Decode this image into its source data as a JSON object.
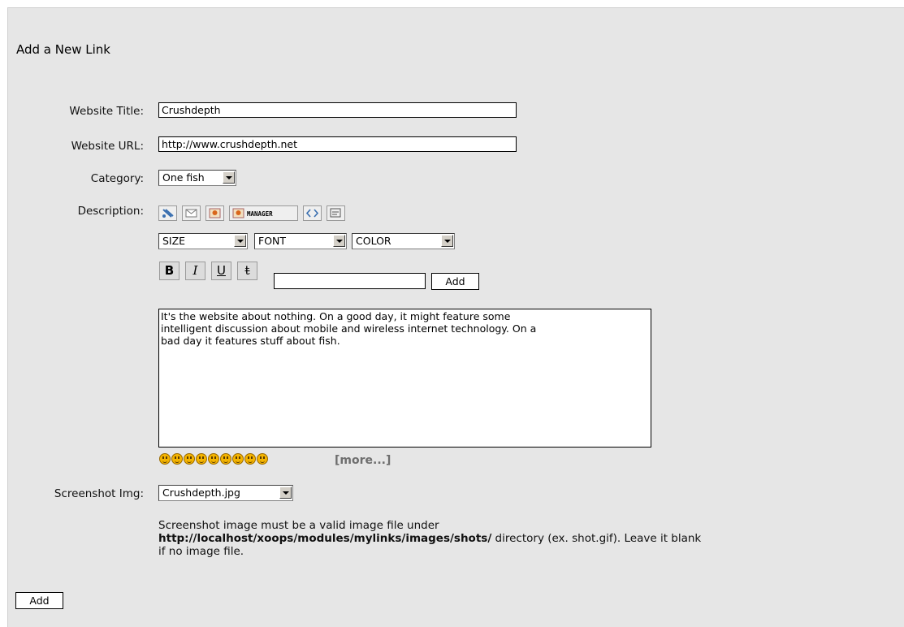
{
  "form": {
    "heading": "Add a New Link",
    "title_label": "Website Title:",
    "title_value": "Crushdepth",
    "url_label": "Website URL:",
    "url_value": "http://www.crushdepth.net",
    "category_label": "Category:",
    "category_value": "One fish",
    "description_label": "Description:",
    "screenshot_label": "Screenshot Img:",
    "screenshot_value": "Crushdepth.jpg",
    "submit_label": "Add"
  },
  "editor": {
    "toolbar_icons": [
      "url-icon",
      "email-icon",
      "image-icon",
      "image-manager-icon",
      "code-icon",
      "quote-icon"
    ],
    "manager_label": "MANAGER",
    "size_select": "SIZE",
    "font_select": "FONT",
    "color_select": "COLOR",
    "bold_label": "B",
    "italic_label": "I",
    "underline_label": "U",
    "strike_label": "t",
    "text_input_value": "",
    "add_label": "Add",
    "description_value": "It's the website about nothing. On a good day, it might feature some\nintelligent discussion about mobile and wireless internet technology. On a\nbad day it features stuff about fish.",
    "smilies": [
      "biggrin-icon",
      "smile-icon",
      "sad-icon",
      "eek-icon",
      "confused-icon",
      "cool-icon",
      "lol-icon",
      "mad-icon",
      "razz-icon"
    ],
    "more_label": "[more...]"
  },
  "help": {
    "line_pre": "Screenshot image must be a valid image file under",
    "path": "http://localhost/xoops/modules/mylinks/images/shots/",
    "line_post": " directory (ex. shot.gif). Leave it blank if no image file."
  }
}
